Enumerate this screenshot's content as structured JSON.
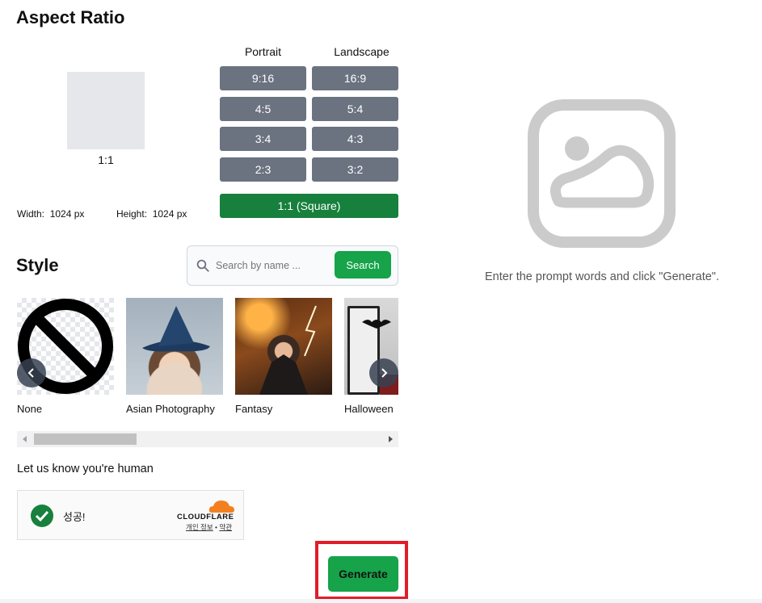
{
  "aspect": {
    "title": "Aspect Ratio",
    "preview_label": "1:1",
    "width_label": "Width:",
    "width_value": "1024 px",
    "height_label": "Height:",
    "height_value": "1024 px",
    "portrait_header": "Portrait",
    "landscape_header": "Landscape",
    "portrait": [
      "9:16",
      "4:5",
      "3:4",
      "2:3"
    ],
    "landscape": [
      "16:9",
      "5:4",
      "4:3",
      "3:2"
    ],
    "square": "1:1 (Square)"
  },
  "style": {
    "title": "Style",
    "search_placeholder": "Search by name ...",
    "search_button": "Search",
    "items": [
      "None",
      "Asian Photography",
      "Fantasy",
      "Halloween"
    ]
  },
  "captcha": {
    "prompt": "Let us know you're human",
    "status": "성공!",
    "brand": "CLOUDFLARE",
    "privacy": "개인 정보",
    "separator": "•",
    "terms": "약관"
  },
  "generate_button": "Generate",
  "output": {
    "hint": "Enter the prompt words and click \"Generate\"."
  },
  "colors": {
    "ratio_button": "#6b7280",
    "selected": "#16803c",
    "accent_green": "#16a34a",
    "highlight_box": "#e11d2a"
  }
}
